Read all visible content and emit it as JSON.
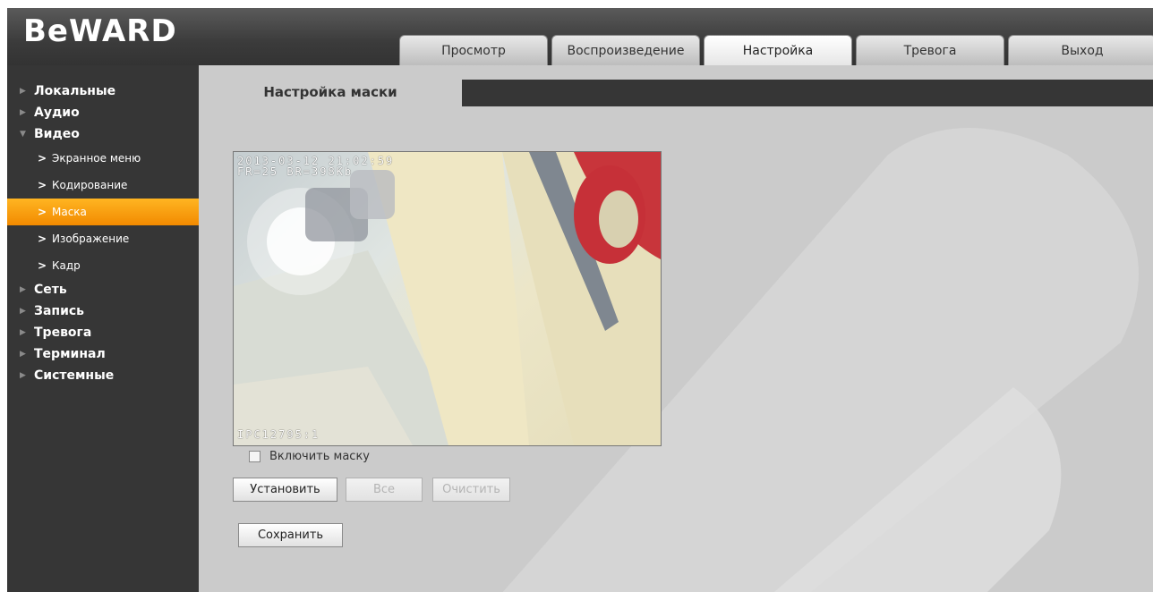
{
  "brand": {
    "logo_text": "BeWARD"
  },
  "nav_tabs": [
    {
      "label": "Просмотр",
      "active": false
    },
    {
      "label": "Воспроизведение",
      "active": false
    },
    {
      "label": "Настройка",
      "active": true
    },
    {
      "label": "Тревога",
      "active": false
    },
    {
      "label": "Выход",
      "active": false
    }
  ],
  "sidebar": {
    "items": [
      {
        "label": "Локальные",
        "expanded": false
      },
      {
        "label": "Аудио",
        "expanded": false
      },
      {
        "label": "Видео",
        "expanded": true,
        "children": [
          {
            "label": "Экранное меню",
            "active": false
          },
          {
            "label": "Кодирование",
            "active": false
          },
          {
            "label": "Маска",
            "active": true
          },
          {
            "label": "Изображение",
            "active": false
          },
          {
            "label": "Кадр",
            "active": false
          }
        ]
      },
      {
        "label": "Сеть",
        "expanded": false
      },
      {
        "label": "Запись",
        "expanded": false
      },
      {
        "label": "Тревога",
        "expanded": false
      },
      {
        "label": "Терминал",
        "expanded": false
      },
      {
        "label": "Системные",
        "expanded": false
      }
    ]
  },
  "main": {
    "section_title": "Настройка маски",
    "video": {
      "osd_timestamp": "2013-03-12 21:02:59",
      "osd_stats": "FR=25 BR=398Kb",
      "osd_camera_id": "IPC12795:1"
    },
    "enable_mask": {
      "label": "Включить маску",
      "checked": false
    },
    "buttons": {
      "set": "Установить",
      "all": "Все",
      "clear": "Очистить",
      "save": "Сохранить"
    }
  },
  "colors": {
    "header_bg": "#3b3b3b",
    "sidebar_bg": "#363636",
    "content_bg": "#cbcbcb",
    "accent": "#f7a21a"
  },
  "icons": {
    "nav_collapsed": "triangle-right-icon",
    "nav_expanded": "triangle-down-icon",
    "sub_item": "chevron-right-icon"
  }
}
